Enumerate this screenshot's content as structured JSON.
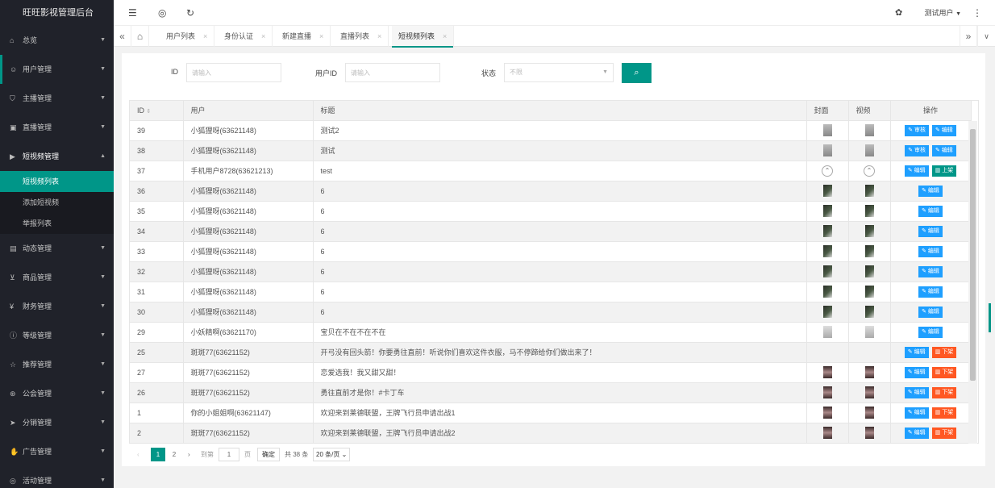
{
  "app": {
    "title": "旺旺影视管理后台"
  },
  "header": {
    "user": "测试用户"
  },
  "sidebar": {
    "items": [
      {
        "label": "总览",
        "icon": "home-icon"
      },
      {
        "label": "用户管理",
        "icon": "user-icon"
      },
      {
        "label": "主播管理",
        "icon": "shield-icon"
      },
      {
        "label": "直播管理",
        "icon": "tv-icon"
      },
      {
        "label": "短视频管理",
        "icon": "play-icon"
      },
      {
        "label": "动态管理",
        "icon": "camera-icon"
      },
      {
        "label": "商品管理",
        "icon": "cart-icon"
      },
      {
        "label": "财务管理",
        "icon": "yen-icon"
      },
      {
        "label": "等级管理",
        "icon": "info-icon"
      },
      {
        "label": "推荐管理",
        "icon": "star-icon"
      },
      {
        "label": "公会管理",
        "icon": "group-icon"
      },
      {
        "label": "分销管理",
        "icon": "send-icon"
      },
      {
        "label": "广告管理",
        "icon": "hand-icon"
      },
      {
        "label": "活动管理",
        "icon": "gift-icon"
      }
    ],
    "sub": [
      "短视频列表",
      "添加短视频",
      "举报列表"
    ]
  },
  "tabs": [
    "用户列表",
    "身份认证",
    "新建直播",
    "直播列表",
    "短视频列表"
  ],
  "filters": {
    "id_label": "ID",
    "id_placeholder": "请输入",
    "uid_label": "用户ID",
    "uid_placeholder": "请输入",
    "status_label": "状态",
    "status_value": "不限"
  },
  "table": {
    "headers": [
      "ID",
      "用户",
      "标题",
      "封面",
      "视频",
      "操作"
    ],
    "rows": [
      {
        "id": "39",
        "user": "小狐狸呀(63621148)",
        "title": "测试2",
        "thumb": "gray",
        "actions": [
          [
            "审核",
            "blue"
          ],
          [
            "编辑",
            "blue"
          ]
        ]
      },
      {
        "id": "38",
        "user": "小狐狸呀(63621148)",
        "title": "测试",
        "thumb": "gray",
        "actions": [
          [
            "审核",
            "blue"
          ],
          [
            "编辑",
            "blue"
          ]
        ]
      },
      {
        "id": "37",
        "user": "手机用户8728(63621213)",
        "title": "test",
        "thumb": "circle",
        "actions": [
          [
            "编辑",
            "blue"
          ],
          [
            "上架",
            "green"
          ]
        ]
      },
      {
        "id": "36",
        "user": "小狐狸呀(63621148)",
        "title": "6",
        "thumb": "dark",
        "actions": [
          [
            "编辑",
            "blue"
          ]
        ]
      },
      {
        "id": "35",
        "user": "小狐狸呀(63621148)",
        "title": "6",
        "thumb": "dark",
        "actions": [
          [
            "编辑",
            "blue"
          ]
        ]
      },
      {
        "id": "34",
        "user": "小狐狸呀(63621148)",
        "title": "6",
        "thumb": "dark",
        "actions": [
          [
            "编辑",
            "blue"
          ]
        ]
      },
      {
        "id": "33",
        "user": "小狐狸呀(63621148)",
        "title": "6",
        "thumb": "dark",
        "actions": [
          [
            "编辑",
            "blue"
          ]
        ]
      },
      {
        "id": "32",
        "user": "小狐狸呀(63621148)",
        "title": "6",
        "thumb": "dark",
        "actions": [
          [
            "编辑",
            "blue"
          ]
        ]
      },
      {
        "id": "31",
        "user": "小狐狸呀(63621148)",
        "title": "6",
        "thumb": "dark",
        "actions": [
          [
            "编辑",
            "blue"
          ]
        ]
      },
      {
        "id": "30",
        "user": "小狐狸呀(63621148)",
        "title": "6",
        "thumb": "dark",
        "actions": [
          [
            "编辑",
            "blue"
          ]
        ]
      },
      {
        "id": "29",
        "user": "小妖精啊(63621170)",
        "title": "宝贝在不在不在不在",
        "thumb": "pale",
        "actions": [
          [
            "编辑",
            "blue"
          ]
        ]
      },
      {
        "id": "25",
        "user": "斑斑77(63621152)",
        "title": "开弓没有回头箭！你要勇往直前！听说你们喜欢这件衣服，马不停蹄给你们做出来了！",
        "thumb": "none",
        "actions": [
          [
            "编辑",
            "blue"
          ],
          [
            "下架",
            "orange"
          ]
        ]
      },
      {
        "id": "27",
        "user": "斑斑77(63621152)",
        "title": "恋爱选我！我又甜又甜！",
        "thumb": "girl",
        "actions": [
          [
            "编辑",
            "blue"
          ],
          [
            "下架",
            "orange"
          ]
        ]
      },
      {
        "id": "26",
        "user": "斑斑77(63621152)",
        "title": "勇往直前才是你！#卡丁车",
        "thumb": "girl",
        "actions": [
          [
            "编辑",
            "blue"
          ],
          [
            "下架",
            "orange"
          ]
        ]
      },
      {
        "id": "1",
        "user": "你的小姐姐啊(63621147)",
        "title": "欢迎来到莱德联盟，王牌飞行员申请出战1",
        "thumb": "girl",
        "actions": [
          [
            "编辑",
            "blue"
          ],
          [
            "下架",
            "orange"
          ]
        ]
      },
      {
        "id": "2",
        "user": "斑斑77(63621152)",
        "title": "欢迎来到莱德联盟，王牌飞行员申请出战2",
        "thumb": "girl",
        "actions": [
          [
            "编辑",
            "blue"
          ],
          [
            "下架",
            "orange"
          ]
        ]
      }
    ]
  },
  "pager": {
    "pages": [
      "1",
      "2"
    ],
    "goto_label": "到第",
    "goto_value": "1",
    "page_unit": "页",
    "confirm": "确定",
    "total": "共 38 条",
    "size": "20 条/页"
  }
}
